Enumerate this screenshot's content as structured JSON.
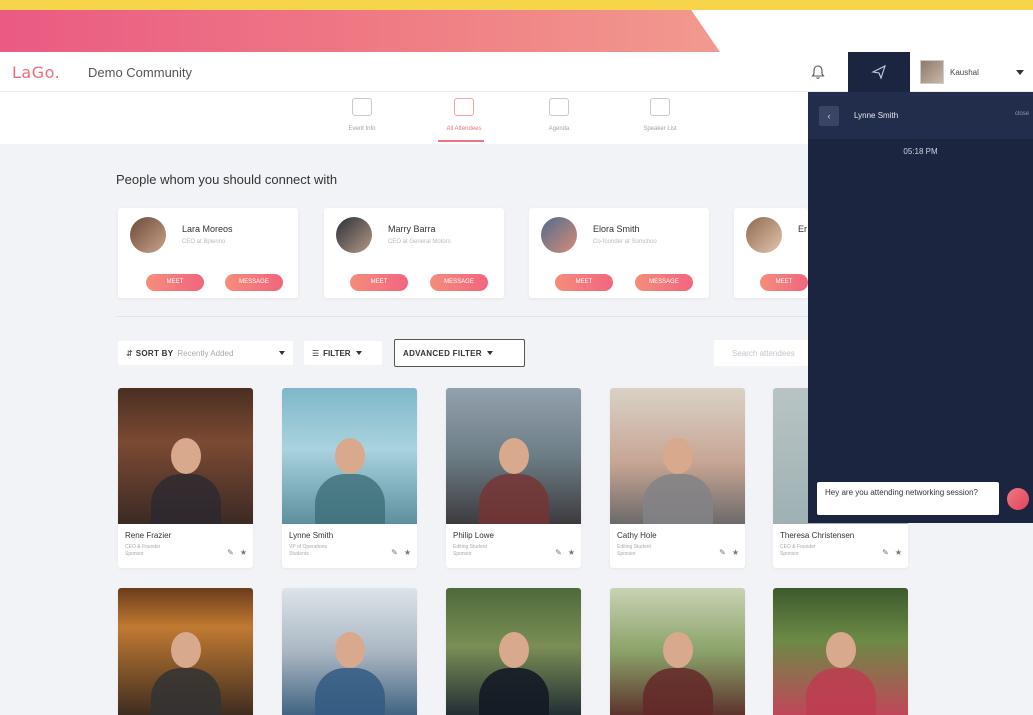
{
  "brand": {
    "logo": "LaGo.",
    "community": "Demo Community"
  },
  "user": {
    "name": "Kaushal"
  },
  "tabs": [
    {
      "label": "Event Info",
      "active": false
    },
    {
      "label": "All Attendees",
      "active": true
    },
    {
      "label": "Agenda",
      "active": false
    },
    {
      "label": "Speaker List",
      "active": false
    }
  ],
  "suggestions": {
    "title": "People whom you should connect with",
    "people": [
      {
        "name": "Lara Moreos",
        "role": "CEO at Bpienno"
      },
      {
        "name": "Marry Barra",
        "role": "CEO at General Motors"
      },
      {
        "name": "Elora Smith",
        "role": "Co-founder at Somchoo"
      },
      {
        "name": "Er",
        "role": ""
      }
    ],
    "meet_label": "MEET",
    "message_label": "MESSAGE"
  },
  "toolbar": {
    "sort_label": "SORT BY",
    "sort_value": "Recently Added",
    "filter_label": "FILTER",
    "advanced_label": "ADVANCED FILTER",
    "search_placeholder": "Search attendees"
  },
  "attendees_row1": [
    {
      "name": "Rene Frazier",
      "role": "CEO & Founder",
      "type": "Sponsor"
    },
    {
      "name": "Lynne Smith",
      "role": "VP of Operations",
      "type": "Students"
    },
    {
      "name": "Philip Lowe",
      "role": "Editing Student",
      "type": "Sponsor"
    },
    {
      "name": "Cathy Hole",
      "role": "Editing Student",
      "type": "Sponsor"
    },
    {
      "name": "Theresa Christensen",
      "role": "CEO & Founder",
      "type": "Sponsor"
    }
  ],
  "chat": {
    "contact": "Lynne Smith",
    "close": "close",
    "time": "05:18 PM",
    "message": "Hey are you attending networking session?"
  },
  "colors": {
    "accent": "#f2657f",
    "navy": "#1b2540",
    "yellow": "#f7d54a"
  }
}
